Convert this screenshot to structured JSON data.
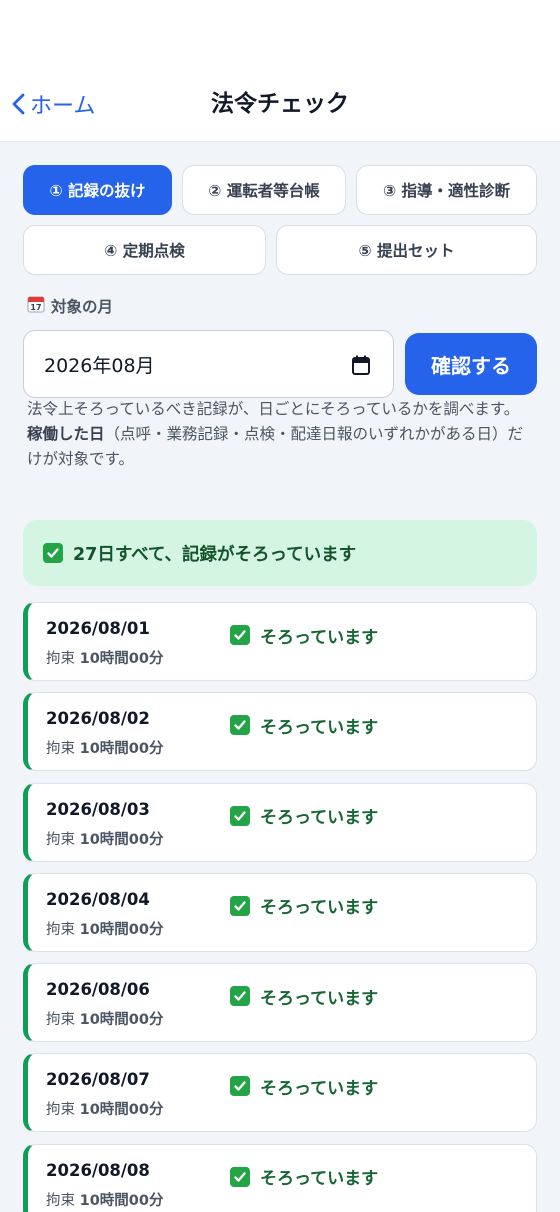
{
  "nav": {
    "back_label": "ホーム",
    "title": "法令チェック"
  },
  "tabs": [
    {
      "label": "① 記録の抜け",
      "active": true
    },
    {
      "label": "② 運転者等台帳",
      "active": false
    },
    {
      "label": "③ 指導・適性診断",
      "active": false
    },
    {
      "label": "④ 定期点検",
      "active": false
    },
    {
      "label": "⑤ 提出セット",
      "active": false
    }
  ],
  "month": {
    "icon": "calendar-icon",
    "label": "対象の月",
    "value": "2026年08月",
    "confirm_label": "確認する"
  },
  "description": {
    "line1": "法令上そろっているべき記録が、日ごとにそろっているかを調べます。",
    "strong": "稼働した日",
    "line2": "（点呼・業務記録・点検・配達日報のいずれかがある日）だけが対象です。"
  },
  "summary": {
    "text": "27日すべて、記録がそろっています"
  },
  "days": [
    {
      "date": "2026/08/01",
      "hours_prefix": "拘束",
      "hours": "10時間00分",
      "status": "そろっています"
    },
    {
      "date": "2026/08/02",
      "hours_prefix": "拘束",
      "hours": "10時間00分",
      "status": "そろっています"
    },
    {
      "date": "2026/08/03",
      "hours_prefix": "拘束",
      "hours": "10時間00分",
      "status": "そろっています"
    },
    {
      "date": "2026/08/04",
      "hours_prefix": "拘束",
      "hours": "10時間00分",
      "status": "そろっています"
    },
    {
      "date": "2026/08/06",
      "hours_prefix": "拘束",
      "hours": "10時間00分",
      "status": "そろっています"
    },
    {
      "date": "2026/08/07",
      "hours_prefix": "拘束",
      "hours": "10時間00分",
      "status": "そろっています"
    },
    {
      "date": "2026/08/08",
      "hours_prefix": "拘束",
      "hours": "10時間00分",
      "status": "そろっています"
    }
  ],
  "colors": {
    "accent": "#2563eb",
    "success": "#0f9d58",
    "success_bg": "#d4f5e1",
    "background": "#f1f4f8"
  }
}
